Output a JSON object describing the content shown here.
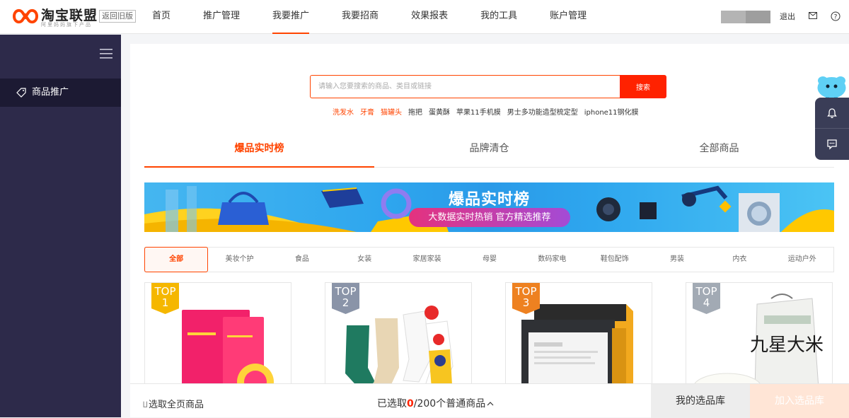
{
  "header": {
    "logo_text": "淘宝联盟",
    "logo_sub": "阿里妈妈旗下产品",
    "old_version": "返回旧版",
    "nav": [
      {
        "label": "首页",
        "active": false
      },
      {
        "label": "推广管理",
        "active": false
      },
      {
        "label": "我要推广",
        "active": true
      },
      {
        "label": "我要招商",
        "active": false
      },
      {
        "label": "效果报表",
        "active": false
      },
      {
        "label": "我的工具",
        "active": false
      },
      {
        "label": "账户管理",
        "active": false
      }
    ],
    "logout": "退出",
    "accent_color": "#ff4400"
  },
  "sidebar": {
    "items": [
      {
        "label": "商品推广",
        "icon": "tag-icon",
        "active": true
      }
    ]
  },
  "search": {
    "placeholder": "请输入您要搜索的商品、类目或链接",
    "button": "搜索",
    "hot_words": [
      {
        "label": "洗发水",
        "highlight": true
      },
      {
        "label": "牙膏",
        "highlight": true
      },
      {
        "label": "猫罐头",
        "highlight": true
      },
      {
        "label": "拖把",
        "highlight": false
      },
      {
        "label": "蛋黄酥",
        "highlight": false
      },
      {
        "label": "苹果11手机膜",
        "highlight": false
      },
      {
        "label": "男士多功能造型梳定型",
        "highlight": false
      },
      {
        "label": "iphone11钢化膜",
        "highlight": false
      }
    ]
  },
  "tabs": [
    {
      "label": "爆品实时榜",
      "active": true
    },
    {
      "label": "品牌清仓",
      "active": false
    },
    {
      "label": "全部商品",
      "active": false
    }
  ],
  "banner": {
    "title": "爆品实时榜",
    "subtitle": "大数据实时热销 官方精选推荐"
  },
  "categories": [
    "全部",
    "美妆个护",
    "食品",
    "女装",
    "家居家装",
    "母婴",
    "数码家电",
    "鞋包配饰",
    "男装",
    "内衣",
    "运动户外"
  ],
  "products": [
    {
      "rank_label": "TOP",
      "rank": "1",
      "image": "pink-product-packaging"
    },
    {
      "rank_label": "TOP",
      "rank": "2",
      "image": "cartoon-socks"
    },
    {
      "rank_label": "TOP",
      "rank": "3",
      "image": "moisturizing-mask-box"
    },
    {
      "rank_label": "TOP",
      "rank": "4",
      "image": "rice-bag",
      "bag_text": "九星大米"
    }
  ],
  "bottom_bar": {
    "select_all": "选取全页商品",
    "selected_prefix": "已选取",
    "selected_count": "0",
    "selected_suffix": "/200个普通商品",
    "pool_button": "我的选品库",
    "add_button": "加入选品库"
  }
}
